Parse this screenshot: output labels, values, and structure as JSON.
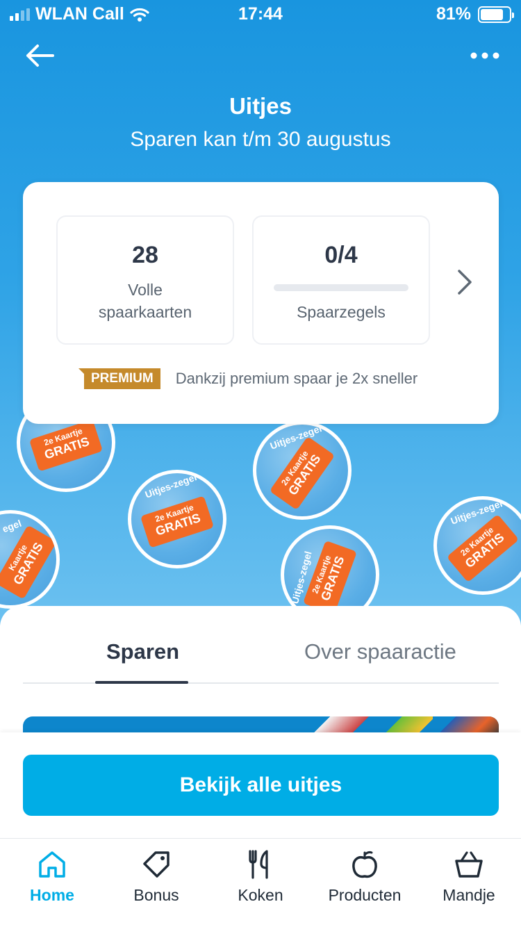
{
  "status_bar": {
    "carrier": "WLAN Call",
    "time": "17:44",
    "battery": "81%",
    "battery_level": 0.81
  },
  "header": {
    "title": "Uitjes",
    "subtitle": "Sparen kan t/m 30 augustus",
    "back_icon": "arrow-left-icon",
    "more_icon": "more-dots-icon"
  },
  "stamps": [
    {
      "label": "",
      "ticket_line1": "2e Kaartje",
      "ticket_line2": "GRATIS"
    },
    {
      "label": "Uitjes-zegel",
      "ticket_line1": "2e Kaartje",
      "ticket_line2": "GRATIS"
    },
    {
      "label": "Uitjes-zegel",
      "ticket_line1": "2e Kaartje",
      "ticket_line2": "GRATIS"
    },
    {
      "label": "egel",
      "ticket_line1": "Kaartje",
      "ticket_line2": "GRATIS"
    },
    {
      "label": "Uitjes-zegel",
      "ticket_line1": "2e Kaartje",
      "ticket_line2": "GRATIS"
    },
    {
      "label": "Uitjes-zegel",
      "ticket_line1": "2e Kaartje",
      "ticket_line2": "GRATIS"
    }
  ],
  "savings_card": {
    "full_cards_value": "28",
    "full_cards_label_line1": "Volle",
    "full_cards_label_line2": "spaarkaarten",
    "stamps_value": "0/4",
    "stamps_progress": 0.0,
    "stamps_label": "Spaarzegels",
    "premium_badge": "PREMIUM",
    "premium_text": "Dankzij premium spaar je 2x sneller"
  },
  "tabs": {
    "active": "Sparen",
    "inactive": "Over spaaractie"
  },
  "cta": {
    "label": "Bekijk alle uitjes"
  },
  "bottom_nav": {
    "items": [
      {
        "label": "Home",
        "icon": "home-icon",
        "active": true
      },
      {
        "label": "Bonus",
        "icon": "tag-icon",
        "active": false
      },
      {
        "label": "Koken",
        "icon": "cutlery-icon",
        "active": false
      },
      {
        "label": "Producten",
        "icon": "apple-icon",
        "active": false
      },
      {
        "label": "Mandje",
        "icon": "basket-icon",
        "active": false
      }
    ]
  },
  "colors": {
    "accent": "#00ade6",
    "hero_top": "#1995df",
    "premium": "#c58a2b",
    "ticket": "#f26a24"
  }
}
